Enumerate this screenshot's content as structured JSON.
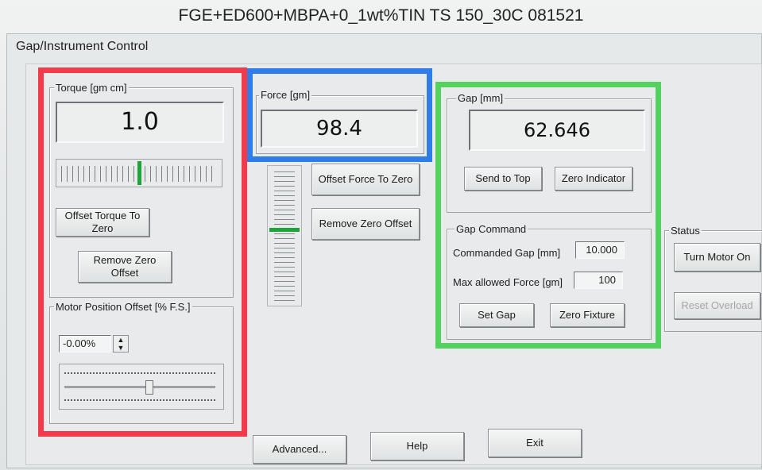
{
  "window_title": "FGE+ED600+MBPA+0_1wt%TIN TS 150_30C 081521",
  "dialog_title": "Gap/Instrument Control",
  "torque": {
    "legend": "Torque [gm cm]",
    "value": "1.0",
    "offset_button": "Offset Torque To Zero",
    "remove_button": "Remove Zero Offset"
  },
  "motor_position": {
    "legend": "Motor Position Offset [% F.S.]",
    "value": "-0.00%"
  },
  "force": {
    "legend": "Force [gm]",
    "value": "98.4",
    "offset_button": "Offset Force To Zero",
    "remove_button": "Remove Zero Offset"
  },
  "gap": {
    "legend": "Gap [mm]",
    "value": "62.646",
    "send_top_button": "Send to Top",
    "zero_indicator_button": "Zero Indicator"
  },
  "gap_command": {
    "legend": "Gap Command",
    "commanded_label": "Commanded Gap [mm]",
    "commanded_value": "10.000",
    "max_force_label": "Max allowed Force [gm]",
    "max_force_value": "100",
    "set_gap_button": "Set Gap",
    "zero_fixture_button": "Zero Fixture"
  },
  "status": {
    "legend": "Status",
    "motor_button": "Turn Motor On",
    "reset_button": "Reset Overload"
  },
  "footer": {
    "advanced_button": "Advanced...",
    "help_button": "Help",
    "exit_button": "Exit"
  },
  "colors": {
    "highlight_torque": "#f23a4a",
    "highlight_force": "#2f7de8",
    "highlight_gap": "#55d15f",
    "indicator_green": "#1fa43a"
  }
}
